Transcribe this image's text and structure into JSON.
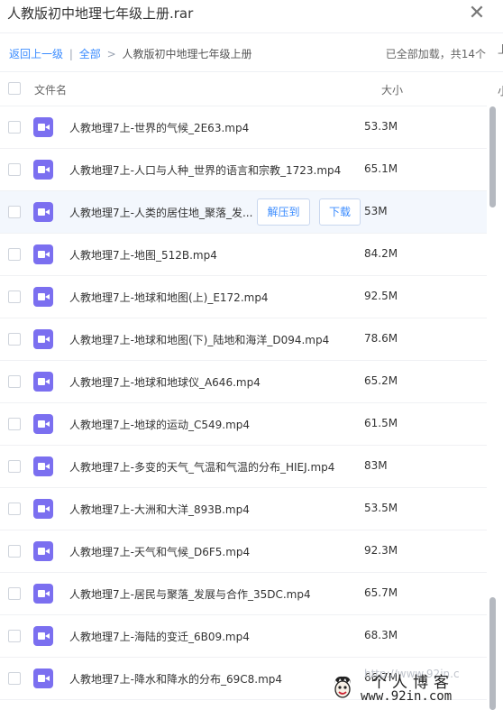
{
  "window": {
    "title": "人教版初中地理七年级上册.rar",
    "close_symbol": "✕"
  },
  "nav": {
    "back_label": "返回上一级",
    "divider": "|",
    "all_label": "全部",
    "crumb_sep": ">",
    "current_folder": "人教版初中地理七年级上册",
    "status": "已全部加载，共14个",
    "edge_char": "上",
    "edge_char2": "小"
  },
  "table": {
    "col_name": "文件名",
    "col_size": "大小"
  },
  "actions": {
    "extract_label": "解压到",
    "download_label": "下载"
  },
  "files": [
    {
      "name": "人教地理7上-世界的气候_2E63.mp4",
      "size": "53.3M"
    },
    {
      "name": "人教地理7上-人口与人种_世界的语言和宗教_1723.mp4",
      "size": "65.1M"
    },
    {
      "name": "人教地理7上-人类的居住地_聚落_发...",
      "size": "53M"
    },
    {
      "name": "人教地理7上-地图_512B.mp4",
      "size": "84.2M"
    },
    {
      "name": "人教地理7上-地球和地图(上)_E172.mp4",
      "size": "92.5M"
    },
    {
      "name": "人教地理7上-地球和地图(下)_陆地和海洋_D094.mp4",
      "size": "78.6M"
    },
    {
      "name": "人教地理7上-地球和地球仪_A646.mp4",
      "size": "65.2M"
    },
    {
      "name": "人教地理7上-地球的运动_C549.mp4",
      "size": "61.5M"
    },
    {
      "name": "人教地理7上-多变的天气_气温和气温的分布_HIEJ.mp4",
      "size": "83M"
    },
    {
      "name": "人教地理7上-大洲和大洋_893B.mp4",
      "size": "53.5M"
    },
    {
      "name": "人教地理7上-天气和气候_D6F5.mp4",
      "size": "92.3M"
    },
    {
      "name": "人教地理7上-居民与聚落_发展与合作_35DC.mp4",
      "size": "65.7M"
    },
    {
      "name": "人教地理7上-海陆的变迁_6B09.mp4",
      "size": "68.3M"
    },
    {
      "name": "人教地理7上-降水和降水的分布_69C8.mp4",
      "size": "66.7M"
    }
  ],
  "watermark": {
    "title": "个人博客",
    "url": "www.92in.com",
    "faded_text": "http://www.92in.c"
  },
  "colors": {
    "accent": "#3b8cff",
    "file_icon": "#7b6ff0",
    "hover_row": "#f3f7fd"
  }
}
